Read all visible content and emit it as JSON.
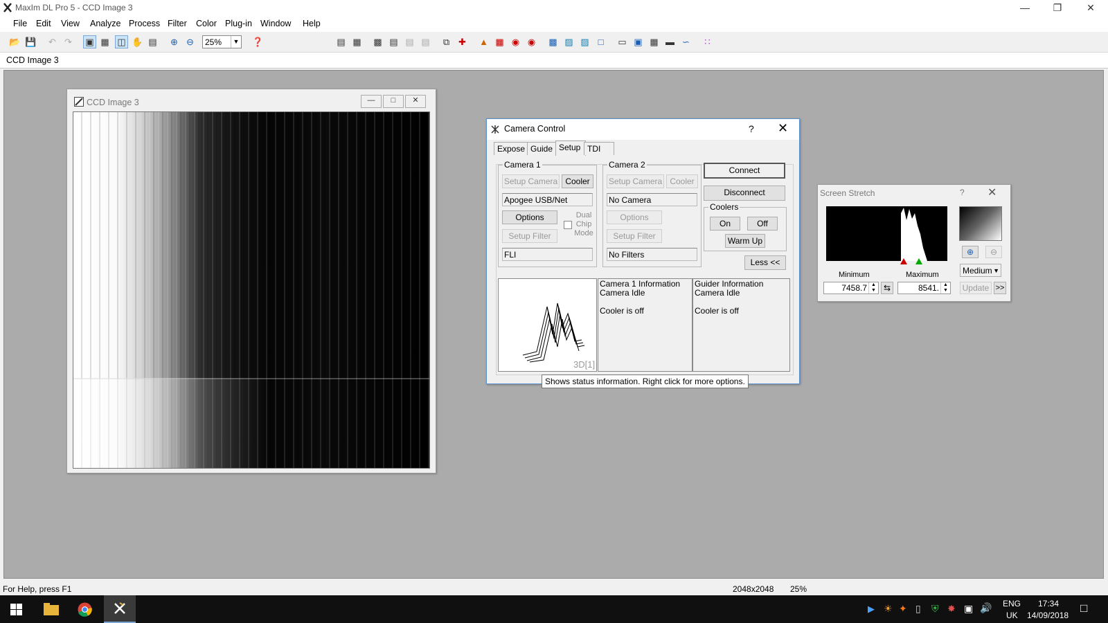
{
  "app": {
    "title": "MaxIm DL Pro 5 - CCD Image 3"
  },
  "menu": [
    "File",
    "Edit",
    "View",
    "Analyze",
    "Process",
    "Filter",
    "Color",
    "Plug-in",
    "Window",
    "Help"
  ],
  "toolbar": {
    "zoom": "25%"
  },
  "doc_tab": "CCD Image 3",
  "ccd_window": {
    "title": "CCD Image 3"
  },
  "camera_control": {
    "title": "Camera Control",
    "help": "?",
    "tabs": [
      "Expose",
      "Guide",
      "Setup",
      "TDI"
    ],
    "selected_tab": "Setup",
    "camera1": {
      "label": "Camera 1",
      "setup_camera": "Setup Camera",
      "cooler": "Cooler",
      "camera_name": "Apogee USB/Net",
      "options": "Options",
      "dual_chip": "Dual Chip Mode",
      "setup_filter": "Setup Filter",
      "filter_name": "FLI"
    },
    "camera2": {
      "label": "Camera 2",
      "setup_camera": "Setup Camera",
      "cooler": "Cooler",
      "camera_name": "No Camera",
      "options": "Options",
      "setup_filter": "Setup Filter",
      "filter_name": "No Filters"
    },
    "connect": "Connect",
    "disconnect": "Disconnect",
    "coolers": {
      "label": "Coolers",
      "on": "On",
      "off": "Off",
      "warm_up": "Warm Up"
    },
    "less": "Less <<",
    "preview_label": "3D[1]",
    "cam1_info": {
      "line1": "Camera 1 Information",
      "line2": "Camera Idle",
      "line3": "Cooler is off"
    },
    "guider_info": {
      "line1": "Guider Information",
      "line2": "Camera Idle",
      "line3": "Cooler is off"
    }
  },
  "tooltip": "Shows status information.  Right click for more options.",
  "screen_stretch": {
    "title": "Screen Stretch",
    "help": "?",
    "minimum_label": "Minimum",
    "maximum_label": "Maximum",
    "minimum_value": "7458.7",
    "maximum_value": "8541.",
    "mode": "Medium",
    "update": "Update",
    "more": ">>"
  },
  "statusbar": {
    "help": "For Help, press F1",
    "size": "2048x2048",
    "zoom": "25%"
  },
  "taskbar": {
    "lang1": "ENG",
    "lang2": "UK",
    "time": "17:34",
    "date": "14/09/2018"
  },
  "colors": {
    "accent": "#5a8fd0",
    "mdi_bg": "#ababab",
    "taskbar": "#101010"
  }
}
